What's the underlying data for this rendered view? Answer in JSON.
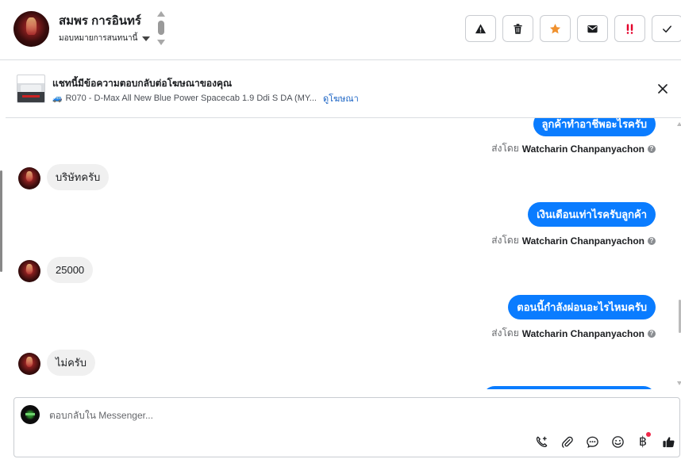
{
  "header": {
    "contact_name": "สมพร การอินทร์",
    "assign_label": "มอบหมายการสนทนานี้",
    "actions": [
      {
        "name": "spam",
        "icon": "warning-icon"
      },
      {
        "name": "delete",
        "icon": "trash-icon"
      },
      {
        "name": "star",
        "icon": "star-icon",
        "color": "#f0912e"
      },
      {
        "name": "mark-unread",
        "icon": "envelope-icon"
      },
      {
        "name": "follow-up",
        "icon": "exclamation-icon",
        "color": "#e4002b"
      },
      {
        "name": "done",
        "icon": "check-icon"
      }
    ]
  },
  "ad_banner": {
    "title": "แชทนี้มีข้อความตอบกลับต่อโฆษณาของคุณ",
    "subtitle": "R070 - D-Max All New Blue Power Spacecab 1.9 Ddi S DA (MY...",
    "link": "ดูโฆษณา"
  },
  "messages": [
    {
      "dir": "out",
      "text": "ลูกค้าทำอาชีพอะไรครับ",
      "sent_prefix": "ส่งโดย",
      "sender": "Watcharin Chanpanyachon"
    },
    {
      "dir": "in",
      "text": "บริษัทครับ"
    },
    {
      "dir": "out",
      "text": "เงินเดือนเท่าไรครับลูกค้า",
      "sent_prefix": "ส่งโดย",
      "sender": "Watcharin Chanpanyachon"
    },
    {
      "dir": "in",
      "text": "25000"
    },
    {
      "dir": "out",
      "text": "ตอนนี้กำลังผ่อนอะไรไหมครับ",
      "sent_prefix": "ส่งโดย",
      "sender": "Watcharin Chanpanyachon"
    },
    {
      "dir": "in",
      "text": "ไม่ครับ"
    }
  ],
  "composer": {
    "placeholder": "ตอบกลับใน Messenger...",
    "value": "",
    "tools": [
      "phone-plus-icon",
      "paperclip-icon",
      "chat-bubble-icon",
      "smiley-icon",
      "baht-icon",
      "thumbs-up-icon"
    ],
    "baht_symbol": "฿",
    "accent": "#0a7cff"
  }
}
